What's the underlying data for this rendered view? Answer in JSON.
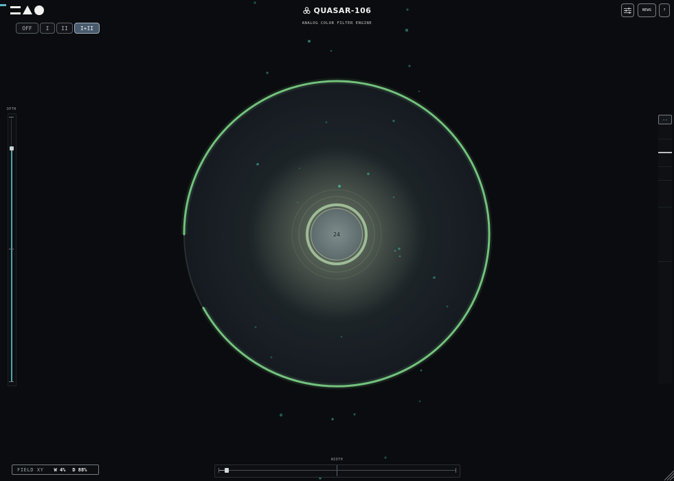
{
  "app": {
    "title": "QUASAR-106",
    "subtitle": "ANALOG COLOR FILTER ENGINE"
  },
  "modes": [
    {
      "label": "OFF",
      "active": false
    },
    {
      "label": "I",
      "active": false
    },
    {
      "label": "II",
      "active": false
    },
    {
      "label": "I+II",
      "active": true
    }
  ],
  "toolbar": {
    "settings_icon": "sliders-icon",
    "news_label": "NEWS",
    "help_label": "?"
  },
  "depth": {
    "label": "DPTH",
    "level": 0.87
  },
  "meter": {
    "button_label": "--",
    "level": 0.9
  },
  "orb": {
    "center_value": "24",
    "ring_progress": 0.97
  },
  "readout": {
    "key": "FIELD XY",
    "w": "W 4%",
    "d": "D 88%"
  },
  "width_slider": {
    "label": "WIDTH",
    "value": 0.04
  },
  "colors": {
    "accent_green": "#74c27e",
    "accent_teal": "#4fa7ad",
    "background": "#0b0c0f"
  }
}
